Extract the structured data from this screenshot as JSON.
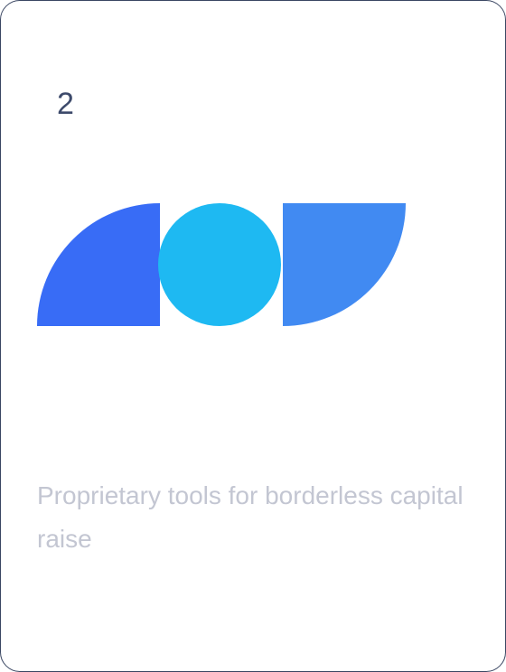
{
  "card": {
    "step_number": "2",
    "caption": "Proprietary tools for borderless capital raise"
  },
  "graphic": {
    "icon": "shapes-illustration",
    "colors": {
      "left_quarter": "#386CF6",
      "circle": "#1EB9F2",
      "right_quarter": "#418AF2"
    }
  },
  "theme": {
    "border": "#3A4662",
    "number_color": "#3D4A6B",
    "caption_color": "#C3C6D2"
  }
}
